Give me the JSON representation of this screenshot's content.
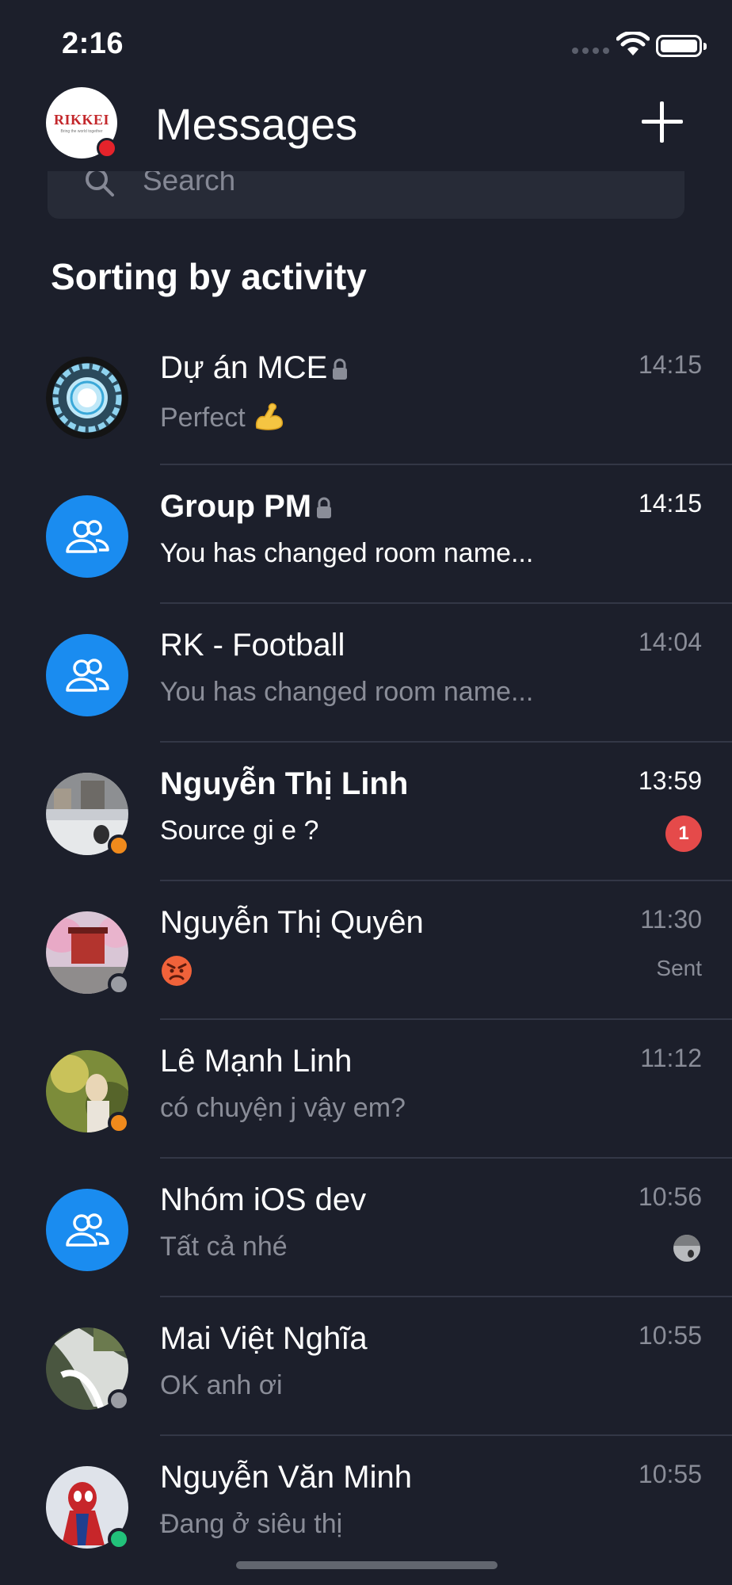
{
  "status_bar": {
    "time": "2:16"
  },
  "header": {
    "title": "Messages",
    "profile_logo_text": "RIKKEI",
    "profile_logo_subtext": "Bring the world together"
  },
  "search": {
    "placeholder": "Search"
  },
  "section_title": "Sorting by activity",
  "colors": {
    "background": "#1c1f2b",
    "group_avatar": "#1a8cf0",
    "unread_badge": "#e54a4a",
    "presence_away": "#f08a1c",
    "presence_offline": "#9a9ca3",
    "presence_online": "#22c17a",
    "profile_dot": "#e5232b"
  },
  "conversations": [
    {
      "name": "Dự án MCE",
      "preview": "Perfect",
      "preview_emoji": "flexed-biceps",
      "time": "14:15",
      "locked": true,
      "avatar": "arc-reactor-image"
    },
    {
      "name": "Group PM",
      "preview": "You has changed room name...",
      "time": "14:15",
      "locked": true,
      "avatar": "group-icon"
    },
    {
      "name": "RK - Football",
      "preview": "You has changed room name...",
      "time": "14:04",
      "avatar": "group-icon"
    },
    {
      "name": "Nguyễn Thị Linh",
      "preview": "Source gi e ?",
      "time": "13:59",
      "unread_count": "1",
      "avatar": "photo",
      "presence": "away"
    },
    {
      "name": "Nguyễn Thị Quyên",
      "preview_emoji": "angry-face",
      "time": "11:30",
      "status": "Sent",
      "avatar": "photo",
      "presence": "offline"
    },
    {
      "name": "Lê Mạnh Linh",
      "preview": "có chuyện j vậy em?",
      "time": "11:12",
      "avatar": "photo",
      "presence": "away"
    },
    {
      "name": "Nhóm iOS dev",
      "preview": "Tất cả nhé",
      "time": "10:56",
      "avatar": "group-icon",
      "seen_by": "avatar"
    },
    {
      "name": "Mai Việt Nghĩa",
      "preview": "OK anh ơi",
      "time": "10:55",
      "avatar": "photo",
      "presence": "offline"
    },
    {
      "name": "Nguyễn Văn Minh",
      "preview": "Đang ở siêu thị",
      "time": "10:55",
      "avatar": "photo",
      "presence": "online"
    }
  ]
}
